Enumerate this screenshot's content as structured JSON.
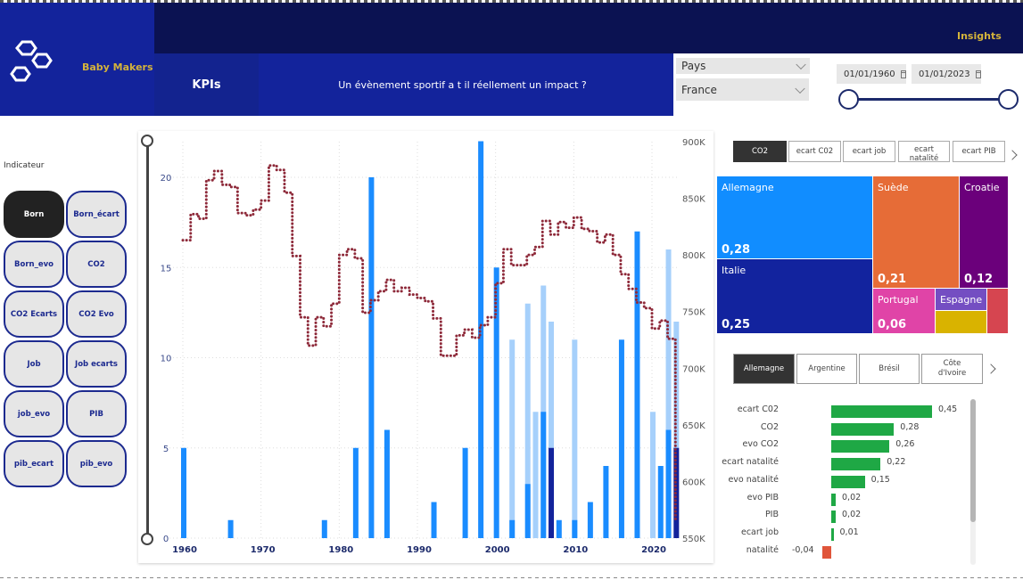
{
  "brand": {
    "name": "Baby Makers",
    "logo_icon": "hexagon-cluster-icon"
  },
  "header": {
    "insights_label": "Insights",
    "kpis_label": "KPIs",
    "question": "Un évènement sportif a t il réellement un impact ?"
  },
  "filters": {
    "pays_label": "Pays",
    "pays_value": "France",
    "date_start": "01/01/1960",
    "date_end": "01/01/2023",
    "range_start_fraction": 0,
    "range_end_fraction": 1
  },
  "indicator_panel": {
    "label": "Indicateur",
    "buttons": [
      {
        "label": "Born",
        "active": true
      },
      {
        "label": "Born_écart",
        "active": false
      },
      {
        "label": "Born_evo",
        "active": false
      },
      {
        "label": "CO2",
        "active": false
      },
      {
        "label": "CO2 Ecarts",
        "active": false
      },
      {
        "label": "CO2 Evo",
        "active": false
      },
      {
        "label": "Job",
        "active": false
      },
      {
        "label": "Job ecarts",
        "active": false
      },
      {
        "label": "job_evo",
        "active": false
      },
      {
        "label": "PIB",
        "active": false
      },
      {
        "label": "pib_ecart",
        "active": false
      },
      {
        "label": "pib_evo",
        "active": false
      }
    ]
  },
  "colors": {
    "bar_light": "#a6d0fb",
    "bar_mid": "#1a8cff",
    "bar_dark": "#13239b",
    "line": "#8e2a3a",
    "positive": "#1fa845",
    "negative": "#e0553a"
  },
  "chart_data": [
    {
      "type": "bar",
      "title": "",
      "xlabel": "",
      "ylabel": "",
      "x_ticks": [
        "1960",
        "1970",
        "1980",
        "1990",
        "2000",
        "2010",
        "2020"
      ],
      "y_ticks_left": [
        "0",
        "5",
        "10",
        "15",
        "20"
      ],
      "y_ticks_right": [
        "550K",
        "600K",
        "650K",
        "700K",
        "750K",
        "800K",
        "850K",
        "900K"
      ],
      "ylim_left": [
        0,
        22
      ],
      "ylim_right": [
        550000,
        900000
      ],
      "xlim": [
        1960,
        2023
      ],
      "grid": true,
      "bar_series": [
        {
          "name": "light",
          "points": [
            [
              2002,
              11
            ],
            [
              2004,
              13
            ],
            [
              2005,
              7
            ],
            [
              2006,
              14
            ],
            [
              2007,
              12
            ],
            [
              2010,
              11
            ],
            [
              2020,
              7
            ],
            [
              2022,
              16
            ],
            [
              2023,
              12
            ]
          ]
        },
        {
          "name": "mid",
          "points": [
            [
              1960,
              5
            ],
            [
              1966,
              1
            ],
            [
              1978,
              1
            ],
            [
              1982,
              5
            ],
            [
              1984,
              20
            ],
            [
              1986,
              6
            ],
            [
              1992,
              2
            ],
            [
              1996,
              5
            ],
            [
              1998,
              22
            ],
            [
              2000,
              15
            ],
            [
              2002,
              1
            ],
            [
              2004,
              3
            ],
            [
              2006,
              7
            ],
            [
              2008,
              1
            ],
            [
              2010,
              1
            ],
            [
              2012,
              2
            ],
            [
              2014,
              4
            ],
            [
              2016,
              11
            ],
            [
              2018,
              17
            ],
            [
              2021,
              4
            ],
            [
              2022,
              6
            ]
          ]
        },
        {
          "name": "dark",
          "points": [
            [
              2007,
              5
            ],
            [
              2023,
              5
            ]
          ]
        }
      ],
      "line_series": {
        "name": "births",
        "axis": "right",
        "points": [
          [
            1960,
            813
          ],
          [
            1961,
            836
          ],
          [
            1962,
            832
          ],
          [
            1963,
            866
          ],
          [
            1964,
            874
          ],
          [
            1965,
            862
          ],
          [
            1966,
            860
          ],
          [
            1967,
            837
          ],
          [
            1968,
            835
          ],
          [
            1969,
            840
          ],
          [
            1970,
            848
          ],
          [
            1971,
            879
          ],
          [
            1972,
            875
          ],
          [
            1973,
            855
          ],
          [
            1974,
            799
          ],
          [
            1975,
            745
          ],
          [
            1976,
            720
          ],
          [
            1977,
            745
          ],
          [
            1978,
            737
          ],
          [
            1979,
            757
          ],
          [
            1980,
            800
          ],
          [
            1981,
            805
          ],
          [
            1982,
            797
          ],
          [
            1983,
            749
          ],
          [
            1984,
            760
          ],
          [
            1985,
            768
          ],
          [
            1986,
            778
          ],
          [
            1987,
            768
          ],
          [
            1988,
            771
          ],
          [
            1989,
            765
          ],
          [
            1990,
            762
          ],
          [
            1991,
            759
          ],
          [
            1992,
            744
          ],
          [
            1993,
            711
          ],
          [
            1994,
            711
          ],
          [
            1995,
            729
          ],
          [
            1996,
            734
          ],
          [
            1997,
            727
          ],
          [
            1998,
            738
          ],
          [
            1999,
            745
          ],
          [
            2000,
            775
          ],
          [
            2001,
            805
          ],
          [
            2002,
            791
          ],
          [
            2003,
            791
          ],
          [
            2004,
            800
          ],
          [
            2005,
            807
          ],
          [
            2006,
            830
          ],
          [
            2007,
            818
          ],
          [
            2008,
            829
          ],
          [
            2009,
            824
          ],
          [
            2010,
            833
          ],
          [
            2011,
            823
          ],
          [
            2012,
            821
          ],
          [
            2013,
            811
          ],
          [
            2014,
            818
          ],
          [
            2015,
            800
          ],
          [
            2016,
            783
          ],
          [
            2017,
            770
          ],
          [
            2018,
            758
          ],
          [
            2019,
            753
          ],
          [
            2020,
            735
          ],
          [
            2021,
            742
          ],
          [
            2022,
            726
          ],
          [
            2023,
            565
          ]
        ]
      }
    },
    {
      "type": "treemap",
      "title": "",
      "tabs": [
        "CO2",
        "ecart C02",
        "ecart job",
        "ecart natalité",
        "ecart PIB"
      ],
      "active_tab": "CO2",
      "items": [
        {
          "label": "Allemagne",
          "value": "0,28",
          "color": "#118dff"
        },
        {
          "label": "Italie",
          "value": "0,25",
          "color": "#12239e"
        },
        {
          "label": "Suède",
          "value": "0,21",
          "color": "#e66c37"
        },
        {
          "label": "Croatie",
          "value": "0,12",
          "color": "#6b007b"
        },
        {
          "label": "Portugal",
          "value": "0,06",
          "color": "#e044a7"
        },
        {
          "label": "Espagne",
          "value": "",
          "color": "#744ec2"
        },
        {
          "label": "",
          "value": "",
          "color": "#d9b300"
        },
        {
          "label": "",
          "value": "",
          "color": "#d64550"
        }
      ]
    },
    {
      "type": "bar",
      "orientation": "horizontal",
      "title": "",
      "country_tabs": [
        "Allemagne",
        "Argentine",
        "Brésil",
        "Côte d'Ivoire"
      ],
      "active_tab": "Allemagne",
      "categories": [
        "ecart C02",
        "CO2",
        "evo CO2",
        "ecart natalité",
        "evo natalité",
        "evo PIB",
        "PIB",
        "ecart job",
        "natalité"
      ],
      "values": [
        0.45,
        0.28,
        0.26,
        0.22,
        0.15,
        0.02,
        0.02,
        0.01,
        -0.04
      ],
      "value_labels": [
        "0,45",
        "0,28",
        "0,26",
        "0,22",
        "0,15",
        "0,02",
        "0,02",
        "0,01",
        "-0,04"
      ]
    }
  ]
}
